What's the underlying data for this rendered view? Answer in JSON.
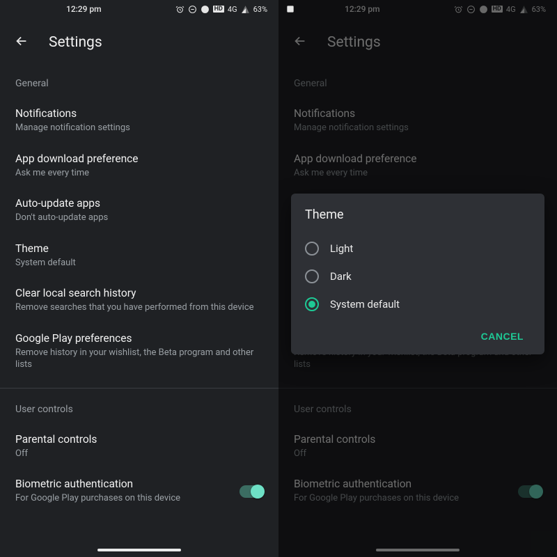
{
  "status": {
    "time": "12:29 pm",
    "network": "4G",
    "battery": "63%"
  },
  "header": {
    "title": "Settings"
  },
  "sections": {
    "general": {
      "label": "General",
      "notifications": {
        "title": "Notifications",
        "sub": "Manage notification settings"
      },
      "app_download": {
        "title": "App download preference",
        "sub": "Ask me every time"
      },
      "auto_update": {
        "title": "Auto-update apps",
        "sub": "Don't auto-update apps"
      },
      "theme": {
        "title": "Theme",
        "sub": "System default"
      },
      "clear_history": {
        "title": "Clear local search history",
        "sub": "Remove searches that you have performed from this device"
      },
      "play_prefs": {
        "title": "Google Play preferences",
        "sub": "Remove history in your wishlist, the Beta program and other lists"
      }
    },
    "user_controls": {
      "label": "User controls",
      "parental": {
        "title": "Parental controls",
        "sub": "Off"
      },
      "biometric": {
        "title": "Biometric authentication",
        "sub": "For Google Play purchases on this device"
      }
    }
  },
  "dialog": {
    "title": "Theme",
    "options": {
      "light": "Light",
      "dark": "Dark",
      "system": "System default"
    },
    "selected": "system",
    "cancel": "CANCEL"
  }
}
